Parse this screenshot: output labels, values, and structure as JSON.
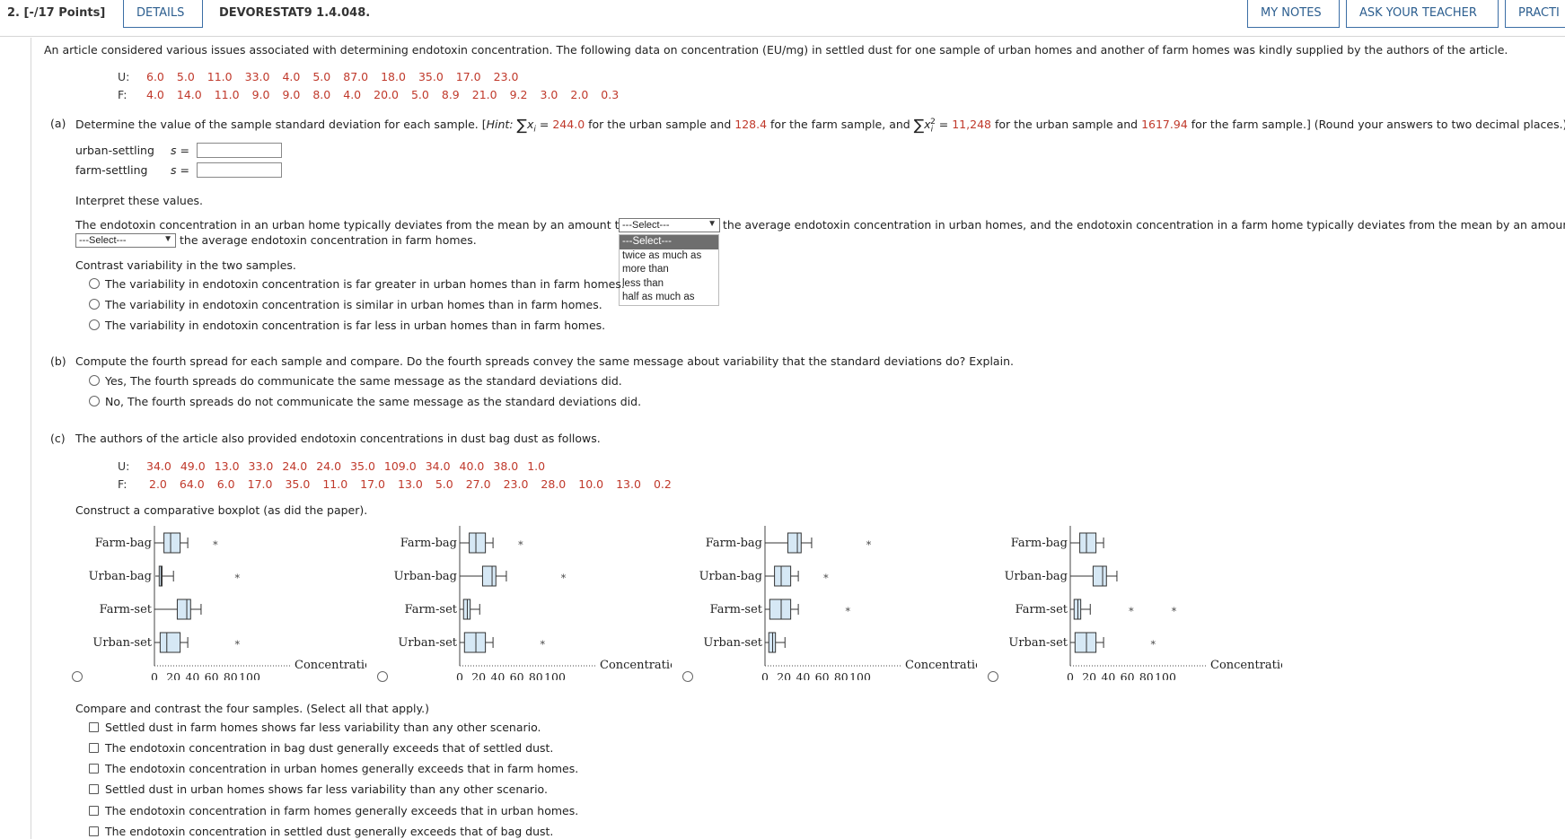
{
  "header": {
    "points": "2.  [-/17 Points]",
    "details_button": "DETAILS",
    "assignment": "DEVORESTAT9 1.4.048.",
    "my_notes_button": "MY NOTES",
    "ask_teacher_button": "ASK YOUR TEACHER",
    "practice_button": "PRACTI"
  },
  "intro": "An article considered various issues associated with determining endotoxin concentration. The following data on concentration (EU/mg) in settled dust for one sample of urban homes and another of farm homes was kindly supplied by the authors of the article.",
  "settled_data": {
    "u_label": "U:",
    "u_values": [
      "6.0",
      "5.0",
      "11.0",
      "33.0",
      "4.0",
      "5.0",
      "87.0",
      "18.0",
      "35.0",
      "17.0",
      "23.0"
    ],
    "f_label": "F:",
    "f_values": [
      "4.0",
      "14.0",
      "11.0",
      "9.0",
      "9.0",
      "8.0",
      "4.0",
      "20.0",
      "5.0",
      "8.9",
      "21.0",
      "9.2",
      "3.0",
      "2.0",
      "0.3"
    ]
  },
  "part_a": {
    "label": "(a)",
    "question_1": "Determine the value of the sample standard deviation for each sample. [",
    "hint_word": "Hint:",
    "sum_x": "x",
    "sum_sub": "i",
    "eq": " = ",
    "urban_sum": "244.0",
    "text_2": " for the urban sample and ",
    "farm_sum": "128.4",
    "text_3": " for the farm sample, and ",
    "sum_sup": "2",
    "urban_sumsq": "11,248",
    "text_4": " for the urban sample and ",
    "farm_sumsq": "1617.94",
    "text_5": " for the farm sample.] (Round your answers to two decimal places.)",
    "urban_label": "urban-settling",
    "farm_label": "farm-settling",
    "s_label": "s =",
    "urban_value": "",
    "farm_value": "",
    "interpret": "Interpret these values.",
    "sentence_1": "The endotoxin concentration in an urban home typically deviates from the mean by an amount that is",
    "select_1_value": "---Select---",
    "sentence_2": "the average endotoxin concentration in urban homes, and the endotoxin concentration in a farm home typically deviates from the mean by an amount that is",
    "select_2_value": "---Select---",
    "sentence_3": "the average endotoxin concentration in farm homes.",
    "dropdown_options": [
      "---Select---",
      "twice as much as",
      "more than",
      "less than",
      "half as much as"
    ],
    "contrast": "Contrast variability in the two samples.",
    "contrast_options": [
      "The variability in endotoxin concentration is far greater in urban homes than in farm homes.",
      "The variability in endotoxin concentration is similar in urban homes than in farm homes.",
      "The variability in endotoxin concentration is far less in urban homes than in farm homes."
    ]
  },
  "part_b": {
    "label": "(b)",
    "question": "Compute the fourth spread for each sample and compare. Do the fourth spreads convey the same message about variability that the standard deviations do? Explain.",
    "options": [
      "Yes, The fourth spreads do communicate the same message as the standard deviations did.",
      "No, The fourth spreads do not communicate the same message as the standard deviations did."
    ]
  },
  "part_c": {
    "label": "(c)",
    "question": "The authors of the article also provided endotoxin concentrations in dust bag dust as follows.",
    "u_label": "U:",
    "u_values": [
      "34.0",
      "49.0",
      "13.0",
      "33.0",
      "24.0",
      "24.0",
      "35.0",
      "109.0",
      "34.0",
      "40.0",
      "38.0",
      "1.0"
    ],
    "f_label": "F:",
    "f_values": [
      "2.0",
      "64.0",
      "6.0",
      "17.0",
      "35.0",
      "11.0",
      "17.0",
      "13.0",
      "5.0",
      "27.0",
      "23.0",
      "28.0",
      "10.0",
      "13.0",
      "0.2"
    ],
    "construct": "Construct a comparative boxplot (as did the paper).",
    "compare": "Compare and contrast the four samples. (Select all that apply.)",
    "compare_options": [
      "Settled dust in farm homes shows far less variability than any other scenario.",
      "The endotoxin concentration in bag dust generally exceeds that of settled dust.",
      "The endotoxin concentration in urban homes generally exceeds that in farm homes.",
      "Settled dust in urban homes shows far less variability than any other scenario.",
      "The endotoxin concentration in farm homes generally exceeds that in urban homes.",
      "The endotoxin concentration in settled dust generally exceeds that of bag dust."
    ]
  },
  "chart_data": [
    {
      "type": "boxplot",
      "xlabel": "Concentration",
      "xticks": [
        "0",
        "20",
        "40",
        "60",
        "80",
        "100"
      ],
      "categories": [
        "Farm-bag",
        "Urban-bag",
        "Farm-set",
        "Urban-set"
      ],
      "boxes": [
        {
          "name": "Farm-bag",
          "min": 0,
          "q1": 10,
          "median": 17,
          "q3": 27,
          "max": 35,
          "outliers": [
            64
          ]
        },
        {
          "name": "Urban-bag",
          "min": 1,
          "q1": 5,
          "median": 7,
          "q3": 8,
          "max": 20,
          "outliers": [
            87
          ]
        },
        {
          "name": "Farm-set",
          "min": 0,
          "q1": 24,
          "median": 34,
          "q3": 38,
          "max": 49,
          "outliers": []
        },
        {
          "name": "Urban-set",
          "min": 0,
          "q1": 6,
          "median": 13,
          "q3": 27,
          "max": 35,
          "outliers": [
            87
          ]
        }
      ]
    },
    {
      "type": "boxplot",
      "xlabel": "Concentration",
      "xticks": [
        "0",
        "20",
        "40",
        "60",
        "80",
        "100"
      ],
      "categories": [
        "Farm-bag",
        "Urban-bag",
        "Farm-set",
        "Urban-set"
      ],
      "boxes": [
        {
          "name": "Farm-bag",
          "min": 0,
          "q1": 10,
          "median": 17,
          "q3": 27,
          "max": 35,
          "outliers": [
            64
          ]
        },
        {
          "name": "Urban-bag",
          "min": 0,
          "q1": 24,
          "median": 34,
          "q3": 38,
          "max": 49,
          "outliers": [
            109
          ]
        },
        {
          "name": "Farm-set",
          "min": 0,
          "q1": 4,
          "median": 8,
          "q3": 11,
          "max": 21,
          "outliers": []
        },
        {
          "name": "Urban-set",
          "min": 0,
          "q1": 5,
          "median": 17,
          "q3": 27,
          "max": 35,
          "outliers": [
            87
          ]
        }
      ]
    },
    {
      "type": "boxplot",
      "xlabel": "Concentration",
      "xticks": [
        "0",
        "20",
        "40",
        "60",
        "80",
        "100"
      ],
      "categories": [
        "Farm-bag",
        "Urban-bag",
        "Farm-set",
        "Urban-set"
      ],
      "boxes": [
        {
          "name": "Farm-bag",
          "min": 0,
          "q1": 24,
          "median": 34,
          "q3": 38,
          "max": 49,
          "outliers": [
            109
          ]
        },
        {
          "name": "Urban-bag",
          "min": 0,
          "q1": 10,
          "median": 17,
          "q3": 27,
          "max": 35,
          "outliers": [
            64
          ]
        },
        {
          "name": "Farm-set",
          "min": 0,
          "q1": 5,
          "median": 17,
          "q3": 27,
          "max": 35,
          "outliers": [
            87
          ]
        },
        {
          "name": "Urban-set",
          "min": 0,
          "q1": 4,
          "median": 8,
          "q3": 11,
          "max": 21,
          "outliers": []
        }
      ]
    },
    {
      "type": "boxplot",
      "xlabel": "Concentration",
      "xticks": [
        "0",
        "20",
        "40",
        "60",
        "80",
        "100"
      ],
      "categories": [
        "Farm-bag",
        "Urban-bag",
        "Farm-set",
        "Urban-set"
      ],
      "boxes": [
        {
          "name": "Farm-bag",
          "min": 0,
          "q1": 10,
          "median": 17,
          "q3": 27,
          "max": 35,
          "outliers": []
        },
        {
          "name": "Urban-bag",
          "min": 0,
          "q1": 24,
          "median": 34,
          "q3": 38,
          "max": 49,
          "outliers": []
        },
        {
          "name": "Farm-set",
          "min": 0,
          "q1": 4,
          "median": 8,
          "q3": 11,
          "max": 21,
          "outliers": [
            64,
            109
          ]
        },
        {
          "name": "Urban-set",
          "min": 0,
          "q1": 5,
          "median": 17,
          "q3": 27,
          "max": 35,
          "outliers": [
            87
          ]
        }
      ]
    }
  ]
}
